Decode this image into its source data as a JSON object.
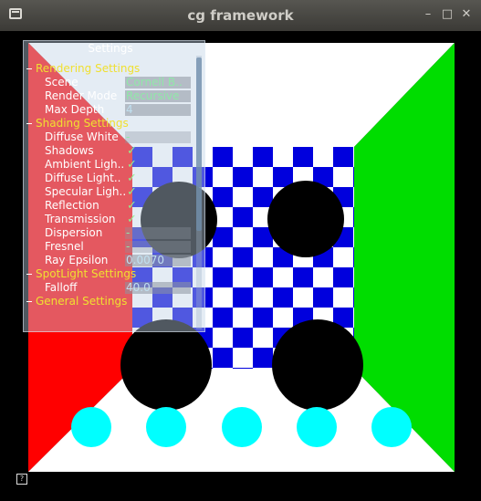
{
  "window": {
    "title": "cg framework",
    "controls": [
      "–",
      "□",
      "✕"
    ]
  },
  "settings": {
    "title": "Settings",
    "groups": {
      "rendering": "Rendering Settings",
      "shading": "Shading Settings",
      "spotlight": "SpotLight Settings",
      "general": "General Settings"
    },
    "rendering": {
      "scene_label": "Scene",
      "scene_value": "Cornell B..",
      "mode_label": "Render Mode",
      "mode_value": "Recursive",
      "depth_label": "Max Depth",
      "depth_value": "4"
    },
    "shading": {
      "diffuse_white_label": "Diffuse White",
      "diffuse_white_value": "-",
      "shadows_label": "Shadows",
      "shadows_value": "✓",
      "ambient_label": "Ambient Ligh..",
      "ambient_value": "✓",
      "diffuse_light_label": "Diffuse Light..",
      "diffuse_light_value": "✓",
      "specular_label": "Specular Ligh..",
      "specular_value": "✓",
      "reflection_label": "Reflection",
      "reflection_value": "✓",
      "transmission_label": "Transmission",
      "transmission_value": "✓",
      "dispersion_label": "Dispersion",
      "dispersion_value": "-",
      "fresnel_label": "Fresnel",
      "fresnel_value": "-",
      "epsilon_label": "Ray Epsilon",
      "epsilon_value": "0.0070"
    },
    "spotlight": {
      "falloff_label": "Falloff",
      "falloff_value": "40.0"
    }
  },
  "help_icon": "?",
  "colors": {
    "left_wall": "#ff0000",
    "right_wall": "#00dd00",
    "floor": "#ffffff",
    "checker_blue": "#0000dd",
    "spheres": "#000000",
    "small_spheres": "#00ffff",
    "group_header": "#f0e030"
  }
}
